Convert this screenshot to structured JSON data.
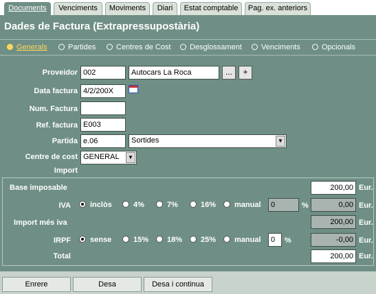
{
  "tabs": [
    "Documents",
    "Venciments",
    "Moviments",
    "Diari",
    "Estat comptable",
    "Pag. ex. anteriors"
  ],
  "title": "Dades de Factura (Extrapressupostària)",
  "subtabs": [
    "Generals",
    "Partides",
    "Centres de Cost",
    "Desglossament",
    "Venciments",
    "Opcionals"
  ],
  "form": {
    "proveidor_label": "Proveidor",
    "proveidor_code": "002",
    "proveidor_name": "Autocars La Roca",
    "dots_btn": "...",
    "plus_btn": "+",
    "data_label": "Data factura",
    "data_value": "4/2/200X",
    "num_label": "Num. Factura",
    "num_value": "",
    "ref_label": "Ref. factura",
    "ref_value": "E003",
    "partida_label": "Partida",
    "partida_code": "e.06",
    "partida_select": "Sortides",
    "centre_label": "Centre de cost",
    "centre_select": "GENERAL",
    "import_label": "Import"
  },
  "import": {
    "base_label": "Base imposable",
    "base_value": "200,00",
    "eur": "Eur.",
    "iva_label": "IVA",
    "iva_opts": [
      "inclòs",
      "4%",
      "7%",
      "16%",
      "manual"
    ],
    "iva_manual_value": "0",
    "pct": "%",
    "iva_amount": "0,00",
    "import_iva_label": "Import més iva",
    "import_iva_value": "200,00",
    "irpf_label": "IRPF",
    "irpf_opts": [
      "sense",
      "15%",
      "18%",
      "25%",
      "manual"
    ],
    "irpf_manual_value": "0",
    "irpf_amount": "-0,00",
    "total_label": "Total",
    "total_value": "200,00"
  },
  "buttons": [
    "Enrere",
    "Desa",
    "Desa i continua"
  ]
}
